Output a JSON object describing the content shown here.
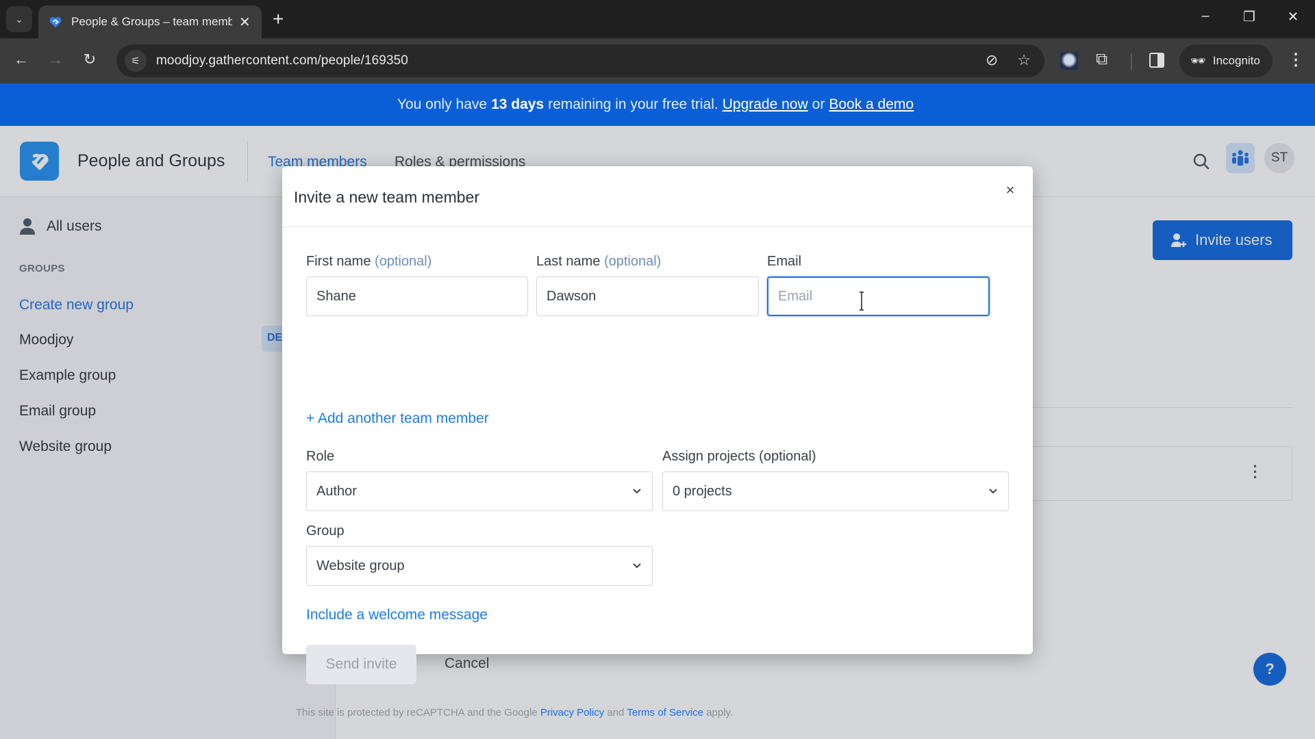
{
  "browser": {
    "tab_title": "People & Groups – team memb",
    "url": "moodjoy.gathercontent.com/people/169350",
    "incognito_label": "Incognito"
  },
  "banner": {
    "prefix": "You only have",
    "days": "13 days",
    "middle": "remaining in your free trial.",
    "upgrade_link": "Upgrade now",
    "or": "or",
    "demo_link": "Book a demo"
  },
  "header": {
    "app_title": "People and Groups",
    "tabs": [
      {
        "label": "Team members",
        "active": true
      },
      {
        "label": "Roles & permissions",
        "active": false
      }
    ],
    "avatar_initials": "ST"
  },
  "sidebar": {
    "all_users": "All users",
    "groups_heading": "GROUPS",
    "create_group": "Create new group",
    "groups": [
      "Moodjoy",
      "Example group",
      "Email group",
      "Website group"
    ],
    "default_badge": "DEFAULT"
  },
  "main": {
    "invite_users_label": "Invite users",
    "help_label": "?"
  },
  "modal": {
    "title": "Invite a new team member",
    "close_label": "×",
    "first_name": {
      "label": "First name",
      "optional": "(optional)",
      "value": "Shane"
    },
    "last_name": {
      "label": "Last name",
      "optional": "(optional)",
      "value": "Dawson"
    },
    "email": {
      "label": "Email",
      "value": "",
      "placeholder": "Email"
    },
    "add_another": "+ Add another team member",
    "role": {
      "label": "Role",
      "value": "Author"
    },
    "projects": {
      "label": "Assign projects (optional)",
      "value": "0 projects"
    },
    "group": {
      "label": "Group",
      "value": "Website group"
    },
    "welcome_link": "Include a welcome message",
    "send_label": "Send invite",
    "cancel_label": "Cancel",
    "recaptcha": {
      "prefix": "This site is protected by reCAPTCHA and the Google",
      "privacy": "Privacy Policy",
      "and": "and",
      "terms": "Terms of Service",
      "suffix": "apply."
    }
  },
  "colors": {
    "brand_blue": "#0b64dd",
    "banner_blue": "#0b5fd6",
    "link_blue": "#1b7de0",
    "logo_blue": "#1e8ff0"
  }
}
